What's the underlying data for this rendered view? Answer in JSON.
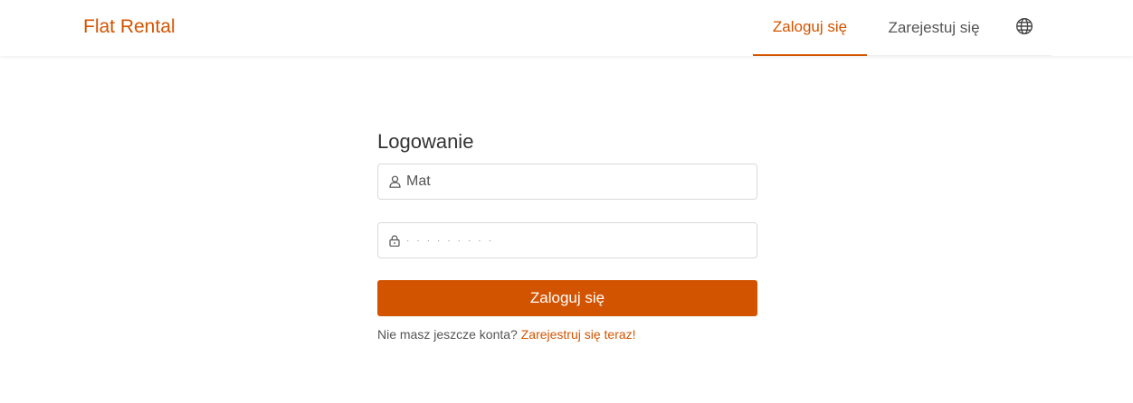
{
  "header": {
    "brand": "Flat Rental",
    "nav": {
      "login": "Zaloguj się",
      "register": "Zarejestuj się",
      "language_icon": "globe-icon"
    }
  },
  "login_form": {
    "title": "Logowanie",
    "username": {
      "value": "Mat",
      "icon": "user-icon"
    },
    "password": {
      "value": "·········",
      "icon": "lock-icon"
    },
    "submit_label": "Zaloguj się",
    "signup_prompt": "Nie masz jeszcze konta?",
    "signup_link": "Zarejestruj się teraz!"
  },
  "colors": {
    "accent": "#d35400",
    "text": "#333333",
    "border": "#d9d9d9"
  }
}
